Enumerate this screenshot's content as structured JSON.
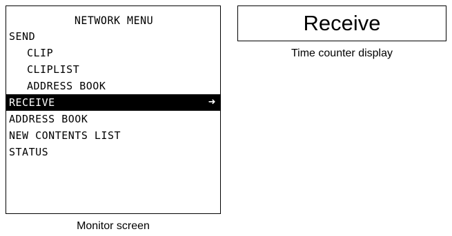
{
  "monitor": {
    "title": "NETWORK MENU",
    "items": [
      {
        "label": "SEND",
        "level": 0,
        "selected": false
      },
      {
        "label": "CLIP",
        "level": 1,
        "selected": false
      },
      {
        "label": "CLIPLIST",
        "level": 1,
        "selected": false
      },
      {
        "label": "ADDRESS BOOK",
        "level": 1,
        "selected": false
      },
      {
        "label": "RECEIVE",
        "level": 0,
        "selected": true,
        "arrow": "➜"
      },
      {
        "label": "ADDRESS BOOK",
        "level": 0,
        "selected": false
      },
      {
        "label": "NEW CONTENTS LIST",
        "level": 0,
        "selected": false
      },
      {
        "label": "STATUS",
        "level": 0,
        "selected": false
      }
    ],
    "caption": "Monitor screen"
  },
  "counter": {
    "value": "Receive",
    "caption": "Time counter display"
  }
}
